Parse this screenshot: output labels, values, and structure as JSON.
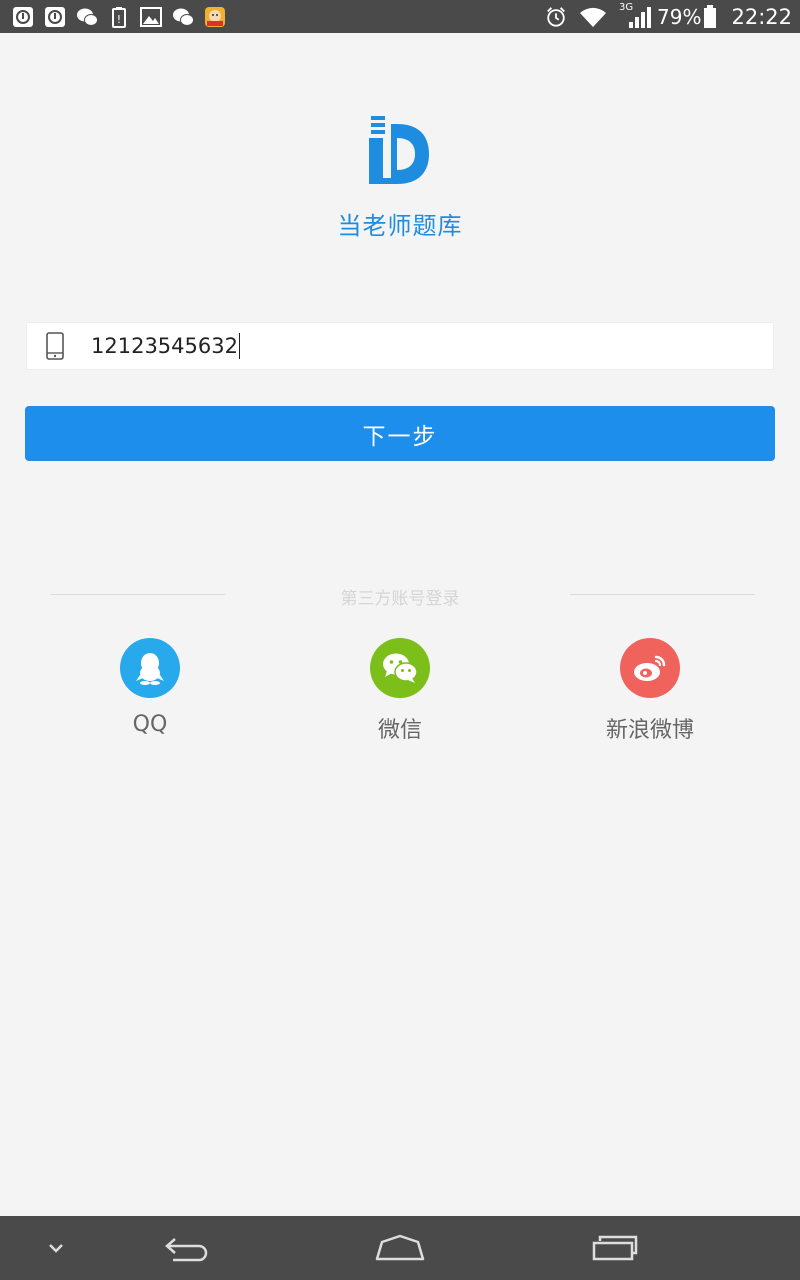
{
  "status_bar": {
    "left_icons": [
      "notification-a-icon",
      "notification-b-icon",
      "wechat-icon",
      "battery-warning-icon",
      "image-icon",
      "wechat-icon",
      "game-app-icon"
    ],
    "network": "3G",
    "battery": "79%",
    "time": "22:22"
  },
  "app": {
    "title": "当老师题库",
    "brand_color": "#1e8ddf"
  },
  "login": {
    "phone_value": "12123545632",
    "next_label": "下一步",
    "next_color": "#1d8eeb"
  },
  "third_party": {
    "label": "第三方账号登录",
    "options": [
      {
        "label": "QQ",
        "icon": "qq-icon",
        "color": "#27a9ec"
      },
      {
        "label": "微信",
        "icon": "wechat-icon",
        "color": "#7cbe1a"
      },
      {
        "label": "新浪微博",
        "icon": "weibo-icon",
        "color": "#f0625c"
      }
    ]
  },
  "nav_bar": {
    "buttons": [
      "collapse-icon",
      "back-icon",
      "home-icon",
      "recents-icon"
    ]
  }
}
